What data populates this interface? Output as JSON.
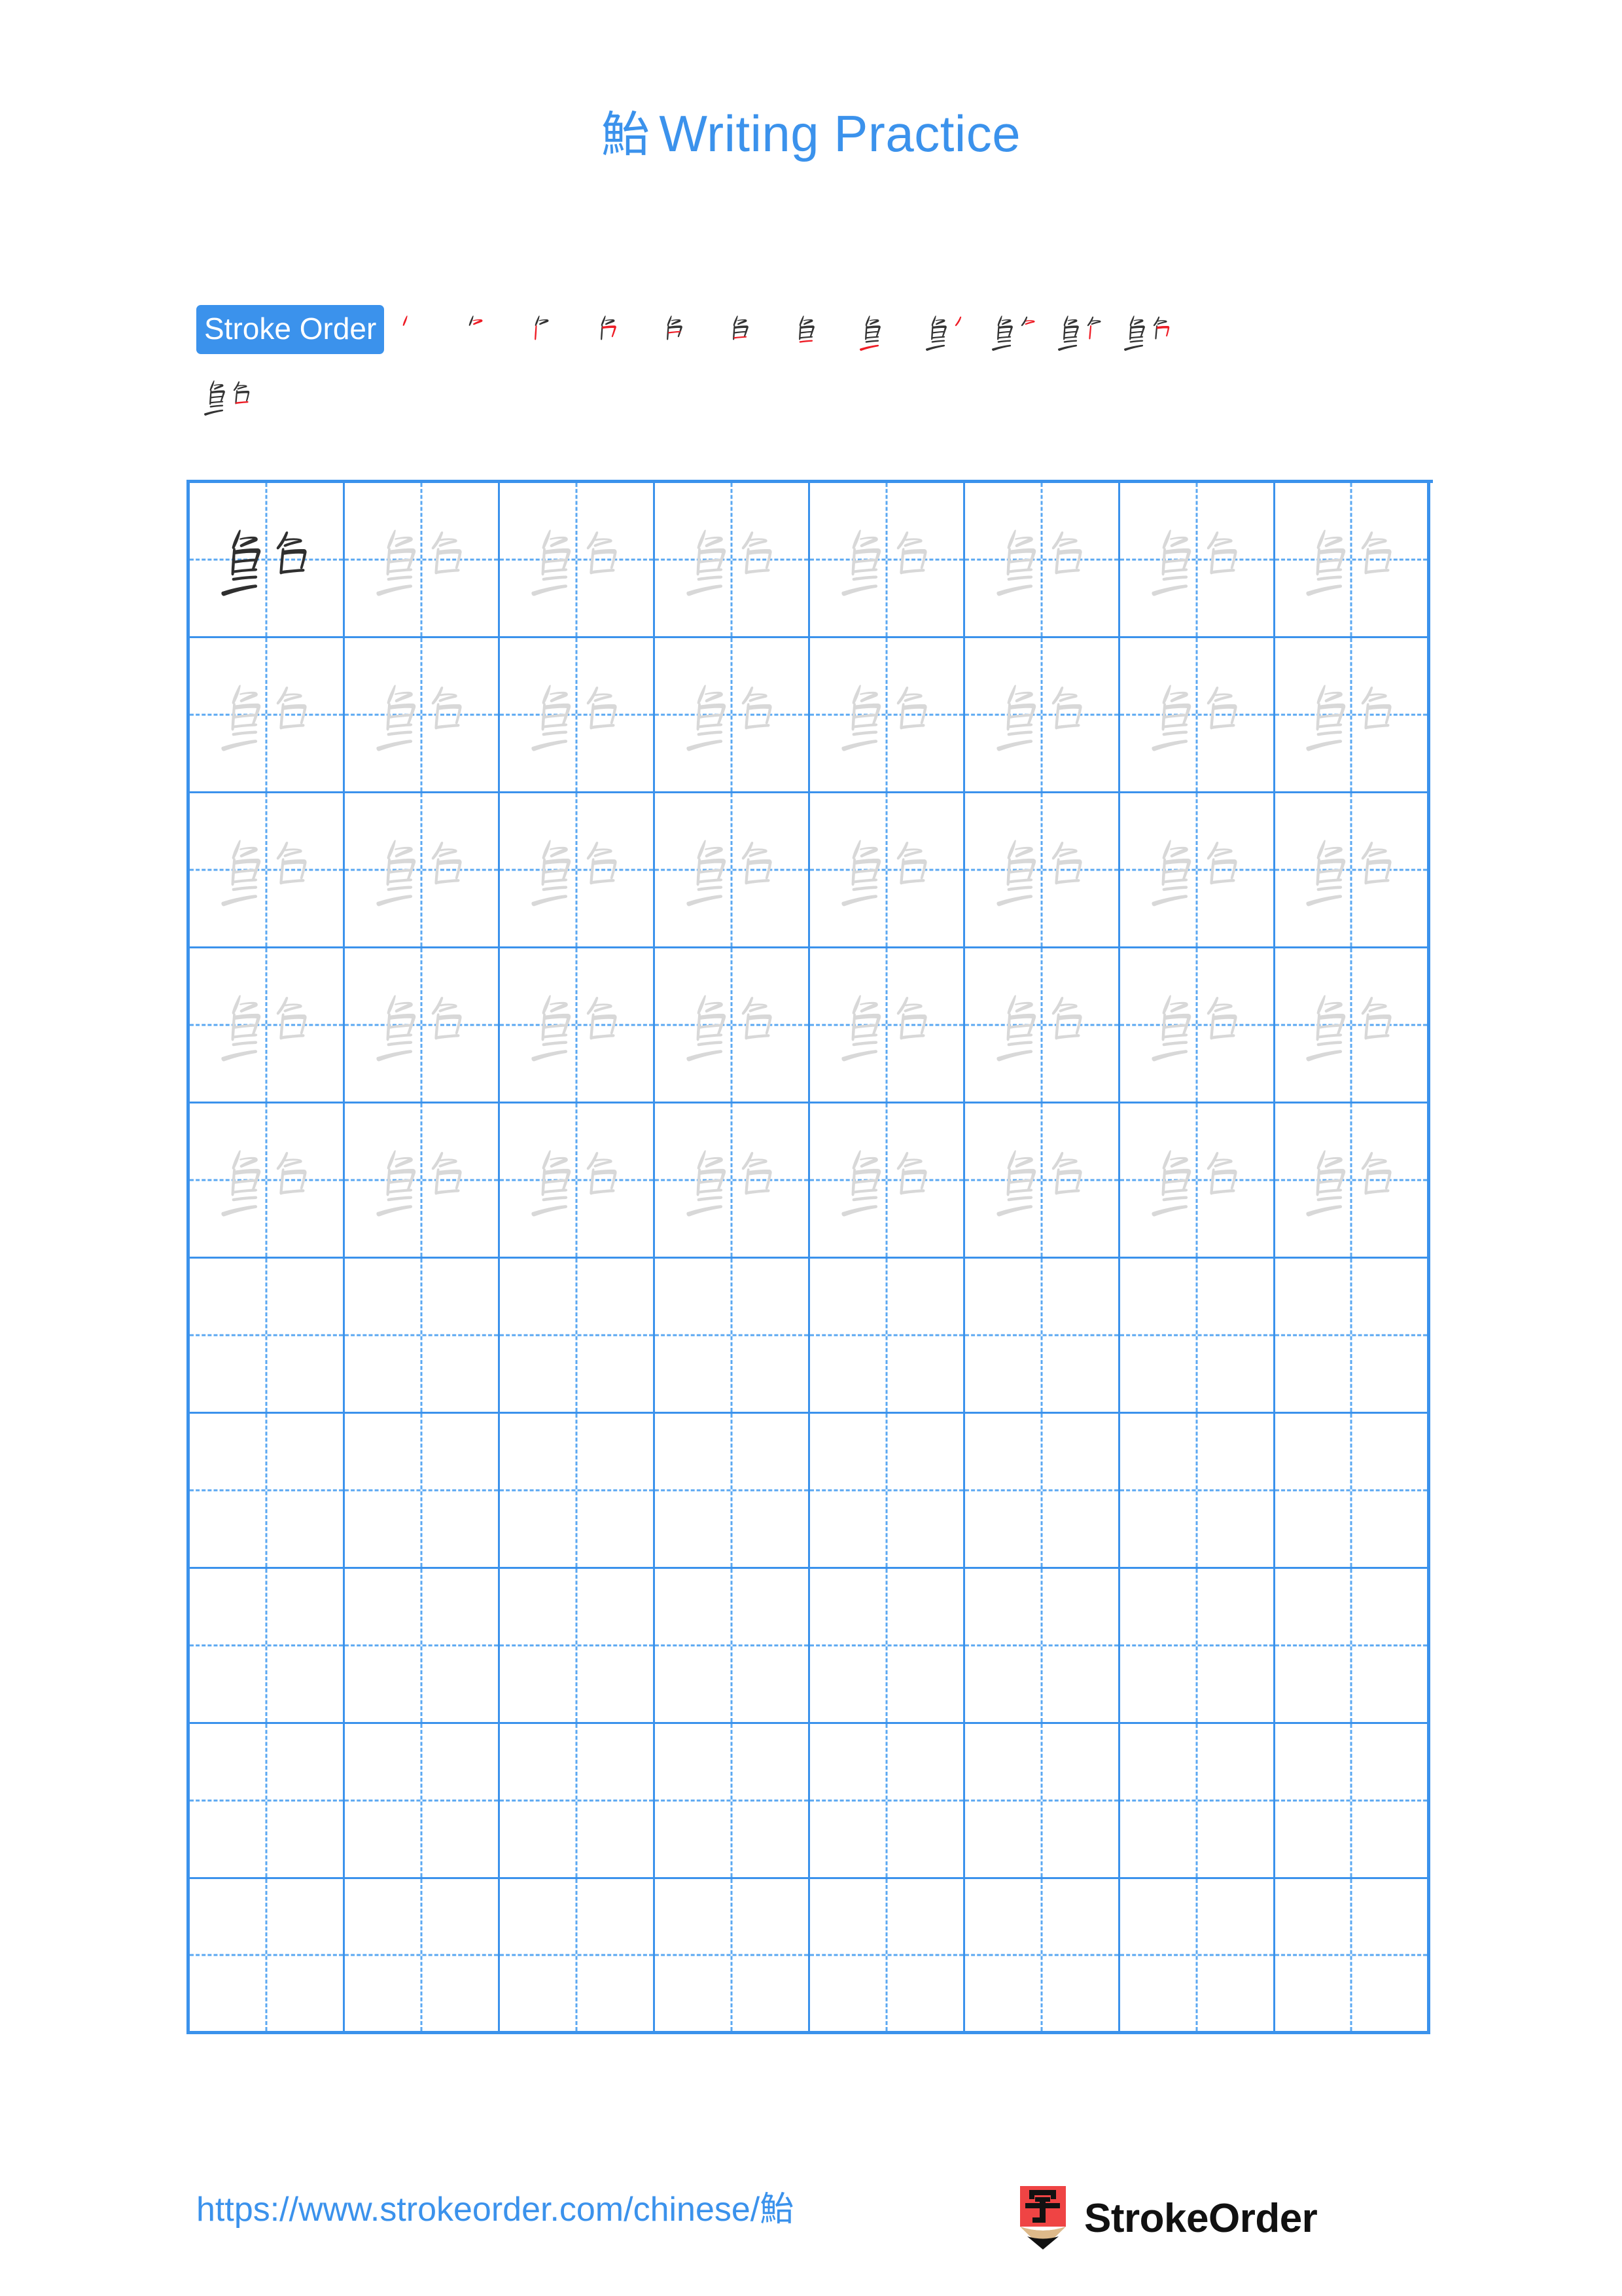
{
  "character": "鮐",
  "header": {
    "title_char": "鮐",
    "title_text": "Writing Practice"
  },
  "stroke_order": {
    "badge_label": "Stroke Order",
    "total_strokes": 13,
    "new_stroke_color": "#ee1c25",
    "drawn_stroke_color": "#333333",
    "steps": [
      {
        "index": 1,
        "strokes_shown": 1
      },
      {
        "index": 2,
        "strokes_shown": 2
      },
      {
        "index": 3,
        "strokes_shown": 3
      },
      {
        "index": 4,
        "strokes_shown": 4
      },
      {
        "index": 5,
        "strokes_shown": 5
      },
      {
        "index": 6,
        "strokes_shown": 6
      },
      {
        "index": 7,
        "strokes_shown": 7
      },
      {
        "index": 8,
        "strokes_shown": 8
      },
      {
        "index": 9,
        "strokes_shown": 9
      },
      {
        "index": 10,
        "strokes_shown": 10
      },
      {
        "index": 11,
        "strokes_shown": 11
      },
      {
        "index": 12,
        "strokes_shown": 12
      },
      {
        "index": 13,
        "strokes_shown": 13
      }
    ]
  },
  "practice_grid": {
    "columns": 8,
    "rows": 10,
    "rows_with_characters": 5,
    "grid_line_color": "#3b92ec",
    "guide_line_color": "#5ba8f2",
    "model_char_color": "#2f2f2f",
    "trace_char_color": "#d8d8d8",
    "cells": [
      [
        "model",
        "trace",
        "trace",
        "trace",
        "trace",
        "trace",
        "trace",
        "trace"
      ],
      [
        "trace",
        "trace",
        "trace",
        "trace",
        "trace",
        "trace",
        "trace",
        "trace"
      ],
      [
        "trace",
        "trace",
        "trace",
        "trace",
        "trace",
        "trace",
        "trace",
        "trace"
      ],
      [
        "trace",
        "trace",
        "trace",
        "trace",
        "trace",
        "trace",
        "trace",
        "trace"
      ],
      [
        "trace",
        "trace",
        "trace",
        "trace",
        "trace",
        "trace",
        "trace",
        "trace"
      ],
      [
        "empty",
        "empty",
        "empty",
        "empty",
        "empty",
        "empty",
        "empty",
        "empty"
      ],
      [
        "empty",
        "empty",
        "empty",
        "empty",
        "empty",
        "empty",
        "empty",
        "empty"
      ],
      [
        "empty",
        "empty",
        "empty",
        "empty",
        "empty",
        "empty",
        "empty",
        "empty"
      ],
      [
        "empty",
        "empty",
        "empty",
        "empty",
        "empty",
        "empty",
        "empty",
        "empty"
      ],
      [
        "empty",
        "empty",
        "empty",
        "empty",
        "empty",
        "empty",
        "empty",
        "empty"
      ]
    ]
  },
  "footer": {
    "url": "https://www.strokeorder.com/chinese/鮐",
    "brand_name": "StrokeOrder",
    "logo_char": "字",
    "logo_body_color": "#ef4444",
    "logo_wood_color": "#ddb98a",
    "logo_tip_color": "#111111"
  }
}
